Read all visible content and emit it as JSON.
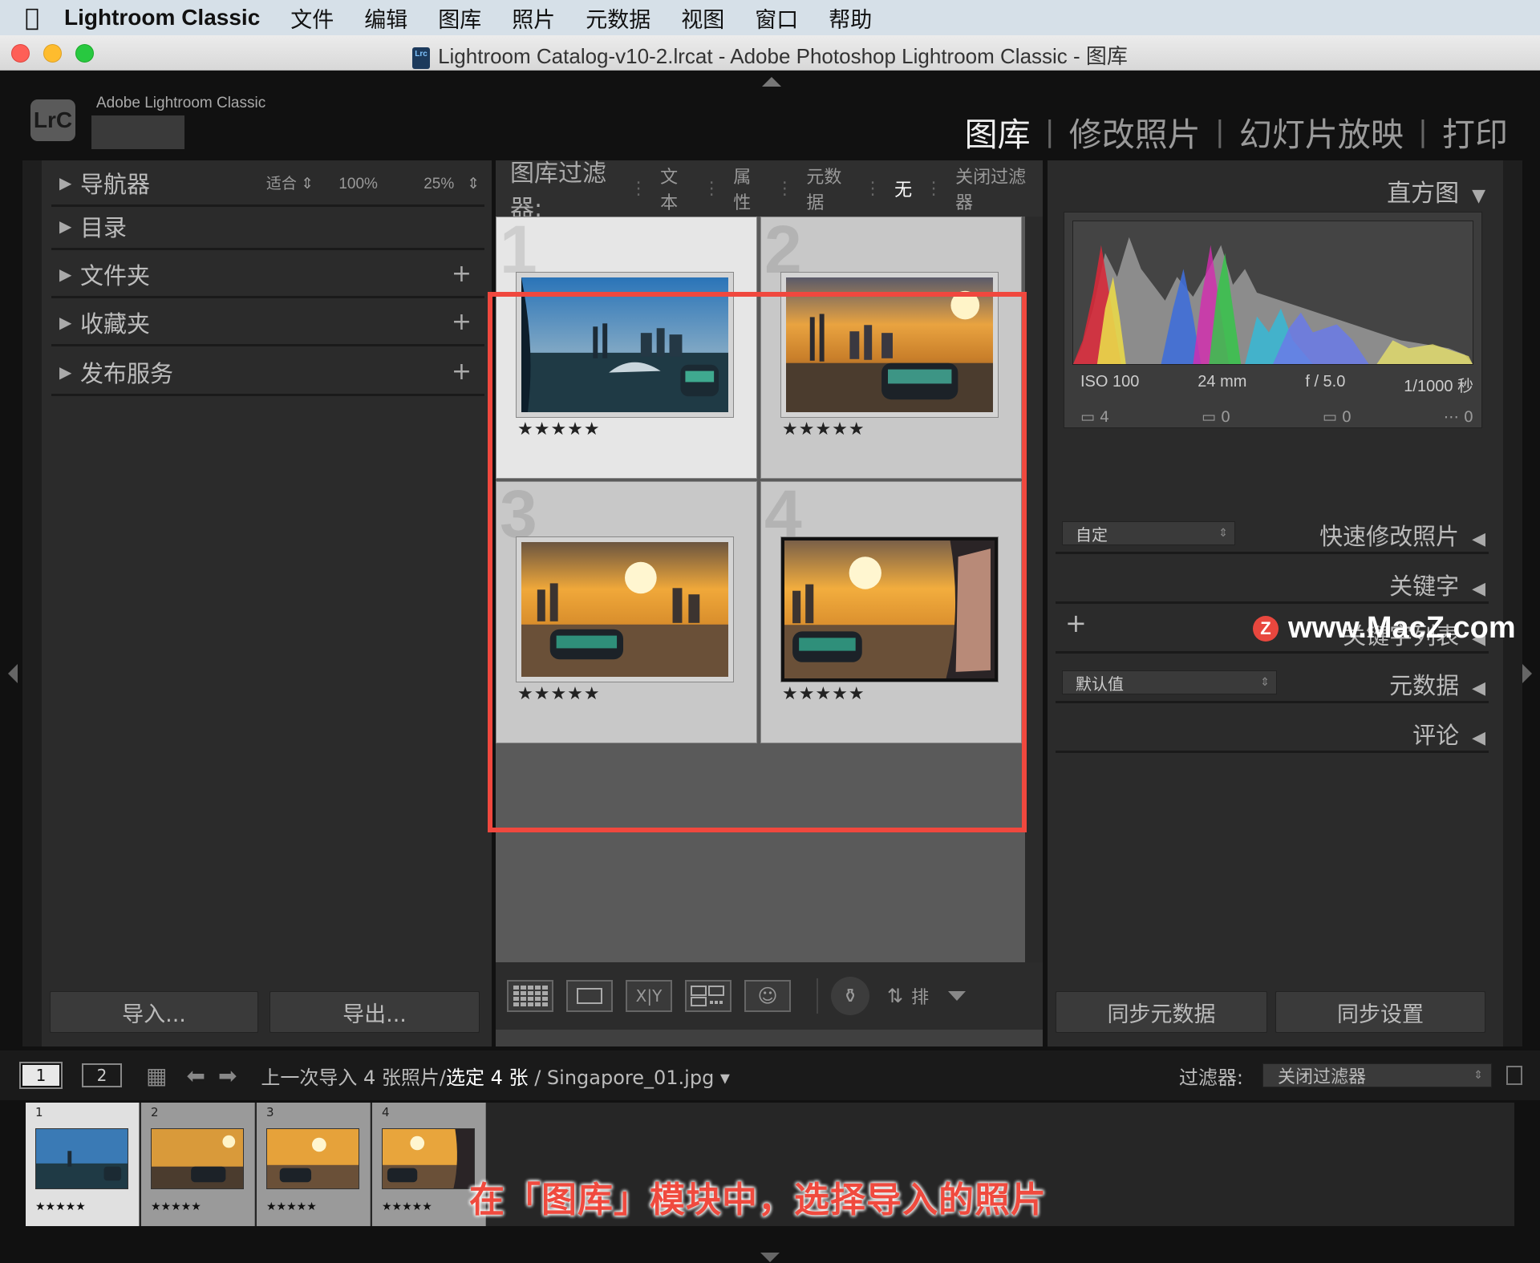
{
  "menubar": {
    "app_name": "Lightroom Classic",
    "items": [
      "文件",
      "编辑",
      "图库",
      "照片",
      "元数据",
      "视图",
      "窗口",
      "帮助"
    ]
  },
  "window": {
    "title": "Lightroom Catalog-v10-2.lrcat - Adobe Photoshop Lightroom Classic - 图库",
    "catalog_icon_text": "Lrc"
  },
  "identity": {
    "badge": "LrC",
    "brand": "Adobe Lightroom Classic",
    "modules": [
      "图库",
      "修改照片",
      "幻灯片放映",
      "打印"
    ],
    "active_module": "图库"
  },
  "left_panel": {
    "navigator": {
      "label": "导航器",
      "fit": "适合",
      "zoom1": "100%",
      "zoom2": "25%"
    },
    "sections": [
      "目录",
      "文件夹",
      "收藏夹",
      "发布服务"
    ],
    "import_label": "导入...",
    "export_label": "导出..."
  },
  "filter_bar": {
    "label": "图库过滤器:",
    "options": [
      "文本",
      "属性",
      "元数据",
      "无",
      "关闭过滤器"
    ],
    "active": "无"
  },
  "grid": {
    "cells": [
      {
        "num": "1",
        "stars": "★★★★★",
        "selected": true
      },
      {
        "num": "2",
        "stars": "★★★★★",
        "selected": false
      },
      {
        "num": "3",
        "stars": "★★★★★",
        "selected": false
      },
      {
        "num": "4",
        "stars": "★★★★★",
        "selected": false
      }
    ]
  },
  "toolbar": {
    "compare_label": "X|Y",
    "sort_label": "排"
  },
  "right_panel": {
    "histogram_label": "直方图",
    "exif": {
      "iso": "ISO 100",
      "focal": "24 mm",
      "aperture": "f / 5.0",
      "shutter": "1/1000 秒"
    },
    "counts": [
      "4",
      "0",
      "0",
      "0"
    ],
    "quick_develop_preset": "自定",
    "quick_develop_label": "快速修改照片",
    "keywording_label": "关键字",
    "keyword_list_label": "关键字列表",
    "metadata_preset": "默认值",
    "metadata_label": "元数据",
    "comments_label": "评论",
    "sync_metadata": "同步元数据",
    "sync_settings": "同步设置"
  },
  "watermark": {
    "logo": "Z",
    "text": "www.MacZ.com"
  },
  "filmstrip": {
    "page1": "1",
    "page2": "2",
    "source_prefix": "上一次导入  4 张照片/",
    "selected": "选定 4 张",
    "file": "/ Singapore_01.jpg ▾",
    "filter_label": "过滤器:",
    "filter_value": "关闭过滤器",
    "thumbs": [
      {
        "num": "1",
        "stars": "★★★★★"
      },
      {
        "num": "2",
        "stars": "★★★★★"
      },
      {
        "num": "3",
        "stars": "★★★★★"
      },
      {
        "num": "4",
        "stars": "★★★★★"
      }
    ]
  },
  "caption": "在「图库」模块中，选择导入的照片",
  "colors": {
    "highlight": "#f0483e",
    "accent_caption": "#f04a3e"
  }
}
